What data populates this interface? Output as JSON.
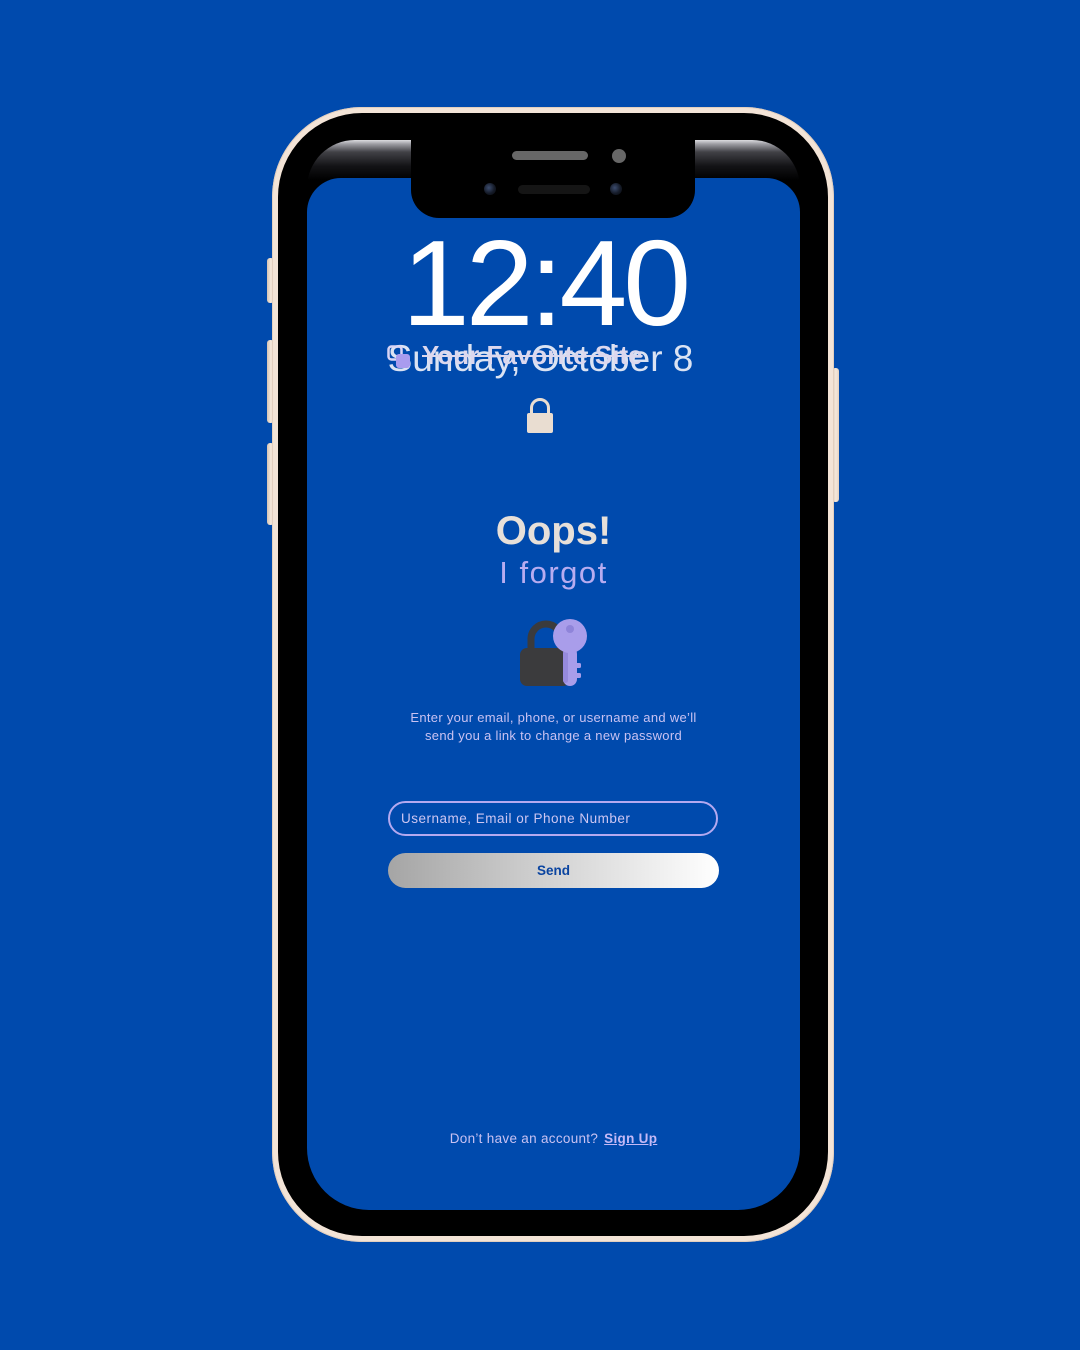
{
  "theme": {
    "background": "#004AAD",
    "frame": "#F3E4D7",
    "accent": "#B4A9F0",
    "heading": "#E7E0D9",
    "text_muted": "#C9C2F2",
    "button_text": "#0A44A0"
  },
  "lock_screen": {
    "time": "12:40",
    "date": "Sunday, October 8",
    "lock_icon": "padlock-icon"
  },
  "brand": {
    "name": "Your Favorite Site",
    "logo_icon": "stacked-squares-icon"
  },
  "recovery": {
    "title": "Oops!",
    "subtitle": "I forgot",
    "illustration_icon": "lock-and-key-icon",
    "instructions": [
      "Enter your email, phone, or username and we’ll",
      "send you a link to change a new password"
    ]
  },
  "form": {
    "identifier": {
      "placeholder": "Username, Email or Phone Number",
      "value": ""
    },
    "send_label": "Send"
  },
  "footer": {
    "prompt": "Don’t have an account?",
    "signup_label": "Sign Up"
  }
}
